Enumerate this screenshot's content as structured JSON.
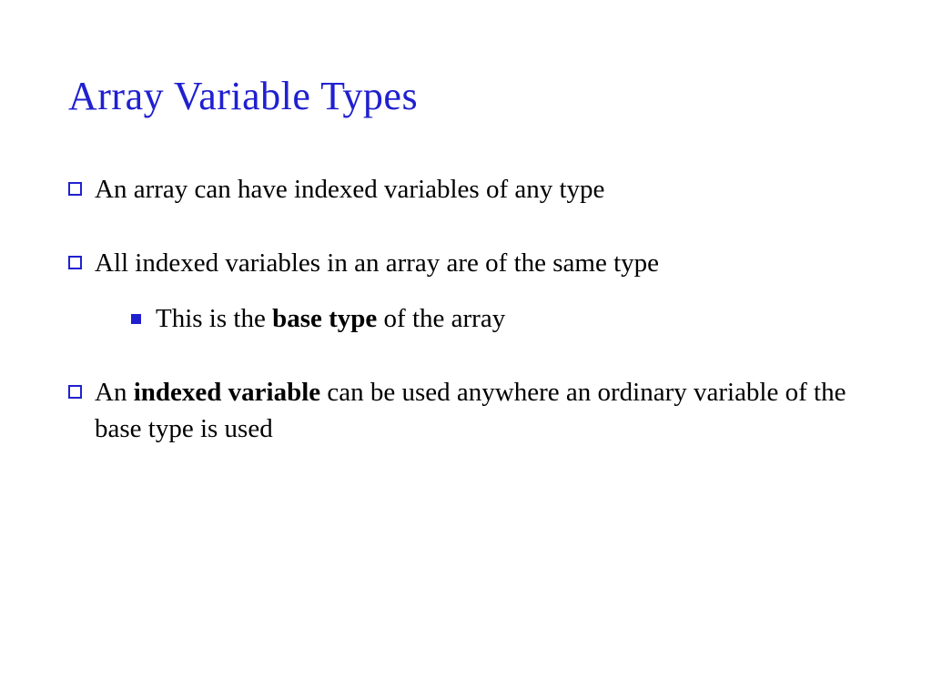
{
  "slide": {
    "title": "Array Variable Types",
    "bullets": [
      {
        "text": "An array can have indexed variables of any type"
      },
      {
        "text_before": "All indexed variables in an array are of the same type",
        "sub": {
          "prefix": "This is the ",
          "bold": "base type",
          "suffix": " of the array"
        }
      },
      {
        "prefix": "An ",
        "bold": "indexed variable",
        "suffix": " can be used anywhere an ordinary variable of the base type is used"
      }
    ]
  }
}
